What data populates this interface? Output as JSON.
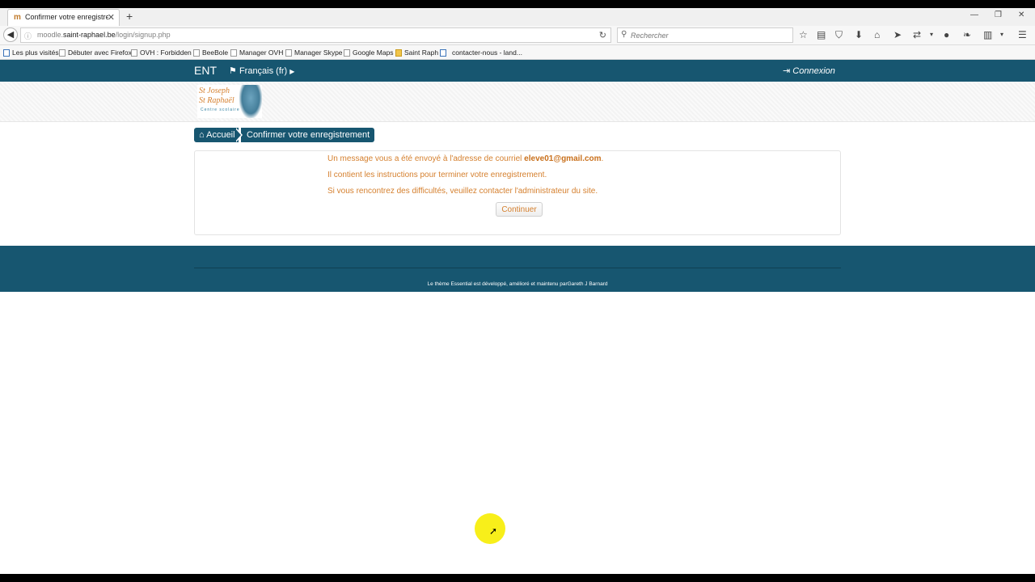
{
  "browser": {
    "tab": {
      "title": "Confirmer votre enregistre...",
      "favicon": "moodle-favicon"
    },
    "url": {
      "prefix": "moodle.",
      "host": "saint-raphael.be",
      "path": "/login/signup.php"
    },
    "search": {
      "placeholder": "Rechercher"
    },
    "bookmarks": [
      {
        "label": "Les plus visités",
        "icon": "blue"
      },
      {
        "label": "Débuter avec Firefox",
        "icon": "page"
      },
      {
        "label": "OVH : Forbidden",
        "icon": "page"
      },
      {
        "label": "BeeBole",
        "icon": "page"
      },
      {
        "label": "Manager OVH",
        "icon": "page"
      },
      {
        "label": "Manager Skype",
        "icon": "page"
      },
      {
        "label": "Google Maps",
        "icon": "page"
      },
      {
        "label": "Saint Raph",
        "icon": "folder"
      },
      {
        "label": "contacter-nous - land...",
        "icon": "blue"
      }
    ]
  },
  "site": {
    "brand": "ENT",
    "language": "Français (fr)",
    "login": "Connexion",
    "logo": {
      "line1": "St Joseph",
      "line2": "St Raphaël",
      "line3": "Centre scolaire"
    }
  },
  "breadcrumb": {
    "home": "Accueil",
    "current": "Confirmer votre enregistrement"
  },
  "main": {
    "line1_prefix": "Un message vous a été envoyé à l'adresse de courriel",
    "email": "eleve01@gmail.com",
    "line1_suffix": ".",
    "line2": "Il contient les instructions pour terminer votre enregistrement.",
    "line3": "Si vous rencontrez des difficultés, veuillez contacter l'administrateur du site.",
    "button": "Continuer"
  },
  "footer": {
    "text": "Le thème Essential est développé, amélioré et maintenu parGareth J Barnard"
  },
  "colors": {
    "brand": "#175670",
    "message": "#d5802f",
    "cursor_highlight": "#f8ef1a"
  }
}
